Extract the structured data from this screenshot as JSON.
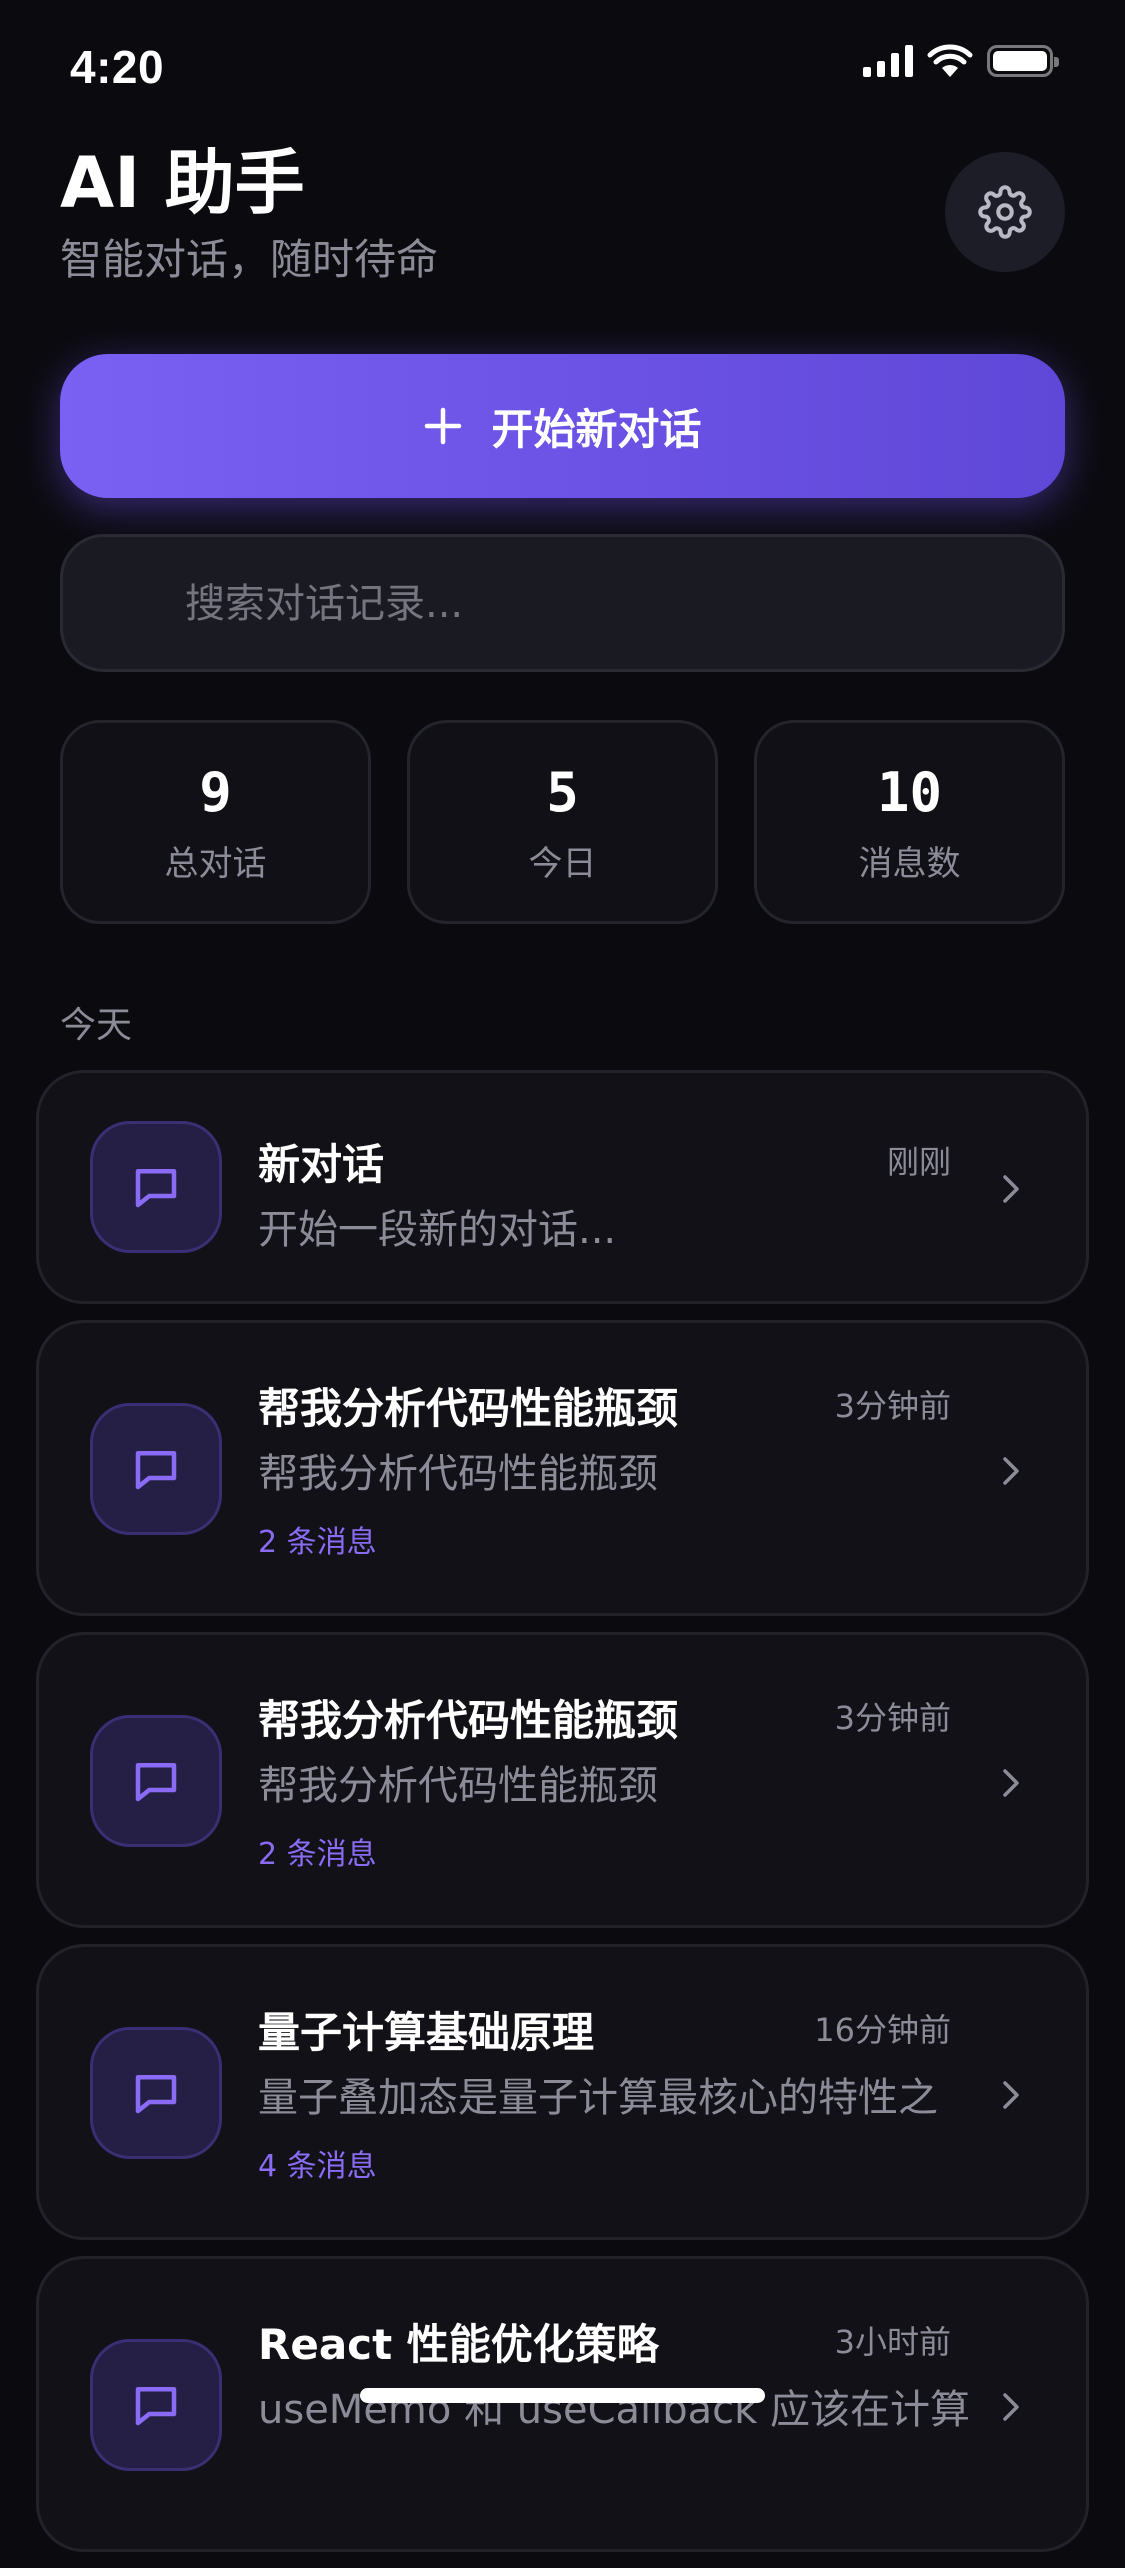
{
  "status_bar": {
    "time": "4:20",
    "icons": [
      "signal-icon",
      "wifi-icon",
      "battery-icon"
    ]
  },
  "header": {
    "title": "AI 助手",
    "subtitle": "智能对话，随时待命",
    "settings_icon": "gear-icon"
  },
  "new_chat": {
    "icon": "plus-icon",
    "label": "开始新对话"
  },
  "search": {
    "placeholder": "搜索对话记录...",
    "value": ""
  },
  "stats": [
    {
      "value": "9",
      "label": "总对话"
    },
    {
      "value": "5",
      "label": "今日"
    },
    {
      "value": "10",
      "label": "消息数"
    }
  ],
  "section": {
    "label": "今天"
  },
  "conversations": [
    {
      "title": "新对话",
      "time": "刚刚",
      "preview": "开始一段新的对话...",
      "count": ""
    },
    {
      "title": "帮我分析代码性能瓶颈",
      "time": "3分钟前",
      "preview": "帮我分析代码性能瓶颈",
      "count": "2  条消息"
    },
    {
      "title": "帮我分析代码性能瓶颈",
      "time": "3分钟前",
      "preview": "帮我分析代码性能瓶颈",
      "count": "2  条消息"
    },
    {
      "title": "量子计算基础原理",
      "time": "16分钟前",
      "preview": "量子叠加态是量子计算最核心的特性之",
      "count": "4  条消息"
    },
    {
      "title": "React 性能优化策略",
      "time": "3小时前",
      "preview": "useMemo 和 useCallback 应该在计算",
      "count": ""
    }
  ],
  "colors": {
    "background": "#0b0b0f",
    "accent": "#7a60f3",
    "accent_text": "#8a6bf5",
    "muted_text": "#8c8c99",
    "card": "#111117"
  }
}
